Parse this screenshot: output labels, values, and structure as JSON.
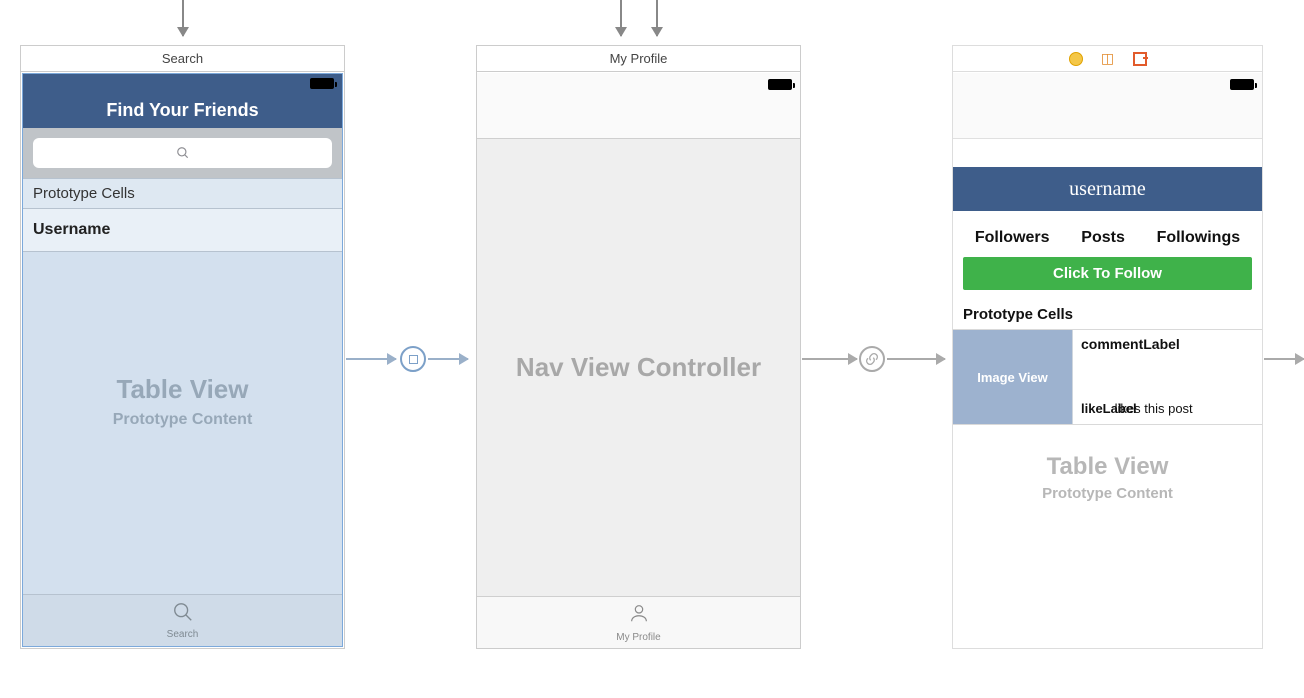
{
  "scene1": {
    "title": "Search",
    "nav_title": "Find Your Friends",
    "search_placeholder": "Search",
    "prototype_header": "Prototype Cells",
    "cell_label": "Username",
    "tv_big": "Table View",
    "tv_small": "Prototype Content",
    "tab_label": "Search"
  },
  "scene2": {
    "title": "My Profile",
    "main_text": "Nav View Controller",
    "tab_label": "My Profile"
  },
  "scene3": {
    "header_text": "username",
    "stats": {
      "followers": "Followers",
      "posts": "Posts",
      "followings": "Followings"
    },
    "follow_btn": "Click To Follow",
    "prototype_header": "Prototype Cells",
    "image_view": "Image View",
    "comment_label": "commentLabel",
    "likes_prefix": "likeLabel",
    "likes_suffix": "likes this post",
    "tv_big": "Table View",
    "tv_small": "Prototype Content"
  }
}
